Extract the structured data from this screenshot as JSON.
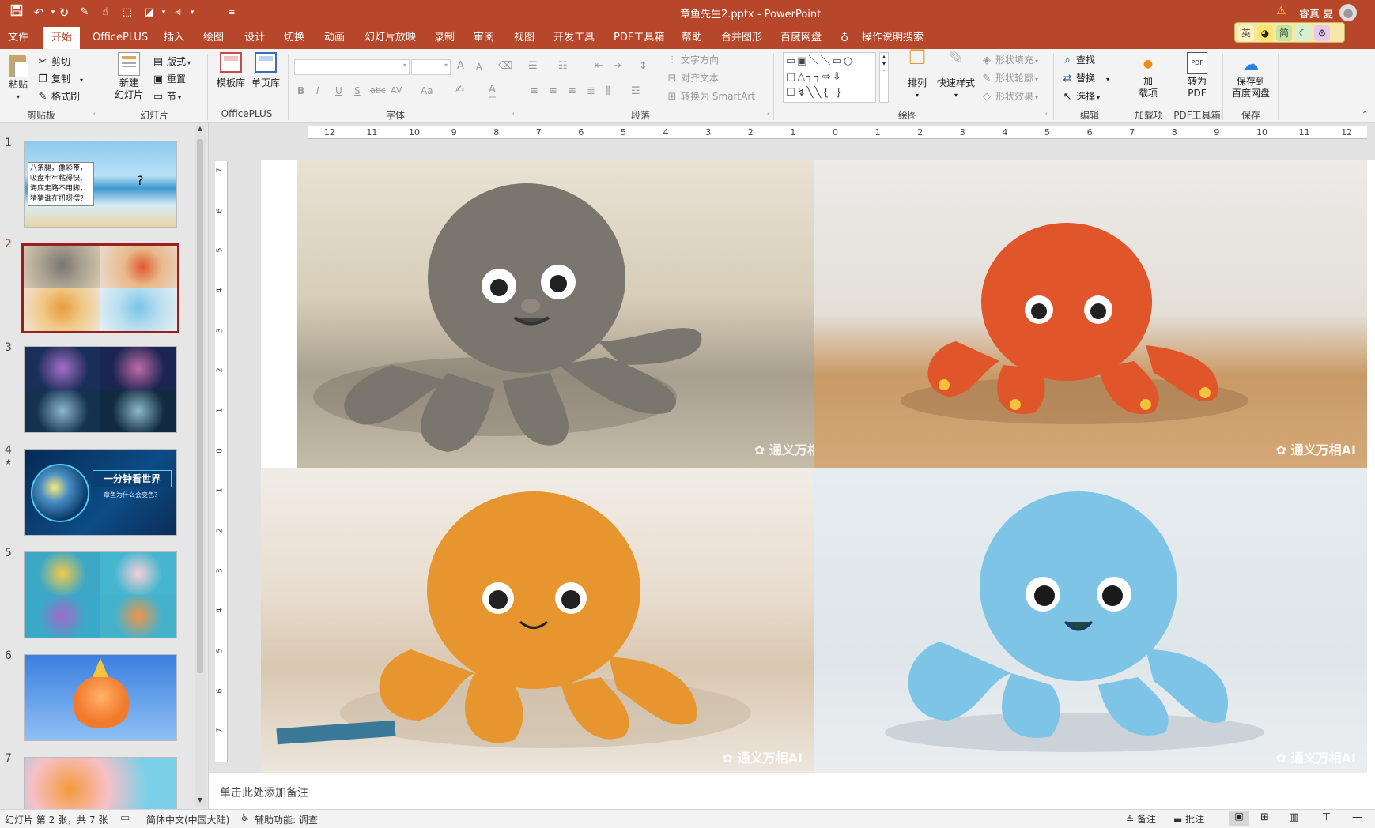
{
  "window": {
    "title": "章鱼先生2.pptx  -  PowerPoint",
    "user": "睿真 夏",
    "warning_icon": "warning-icon"
  },
  "qat": {
    "icons": [
      "save-icon",
      "undo-icon",
      "redo-icon",
      "format-painter-icon",
      "touch-icon",
      "select-icon",
      "shapes-icon",
      "align-icon",
      "more-icon"
    ]
  },
  "badges": [
    "英",
    "简"
  ],
  "tabs": [
    "文件",
    "开始",
    "OfficePLUS",
    "插入",
    "绘图",
    "设计",
    "切换",
    "动画",
    "幻灯片放映",
    "录制",
    "审阅",
    "视图",
    "开发工具",
    "PDF工具箱",
    "帮助",
    "合并图形",
    "百度网盘"
  ],
  "active_tab": "开始",
  "tell_me": "操作说明搜索",
  "ribbon": {
    "clipboard": {
      "paste": "粘贴",
      "cut": "剪切",
      "copy": "复制",
      "painter": "格式刷",
      "label": "剪贴板"
    },
    "slides": {
      "new": "新建\n幻灯片",
      "layout": "版式",
      "reset": "重置",
      "section": "节",
      "label": "幻灯片"
    },
    "officeplus": {
      "template": "模板库",
      "single": "单页库",
      "label": "OfficePLUS"
    },
    "font": {
      "label": "字体",
      "bold": "B",
      "italic": "I",
      "underline": "U",
      "strike": "S",
      "abc": "abc",
      "spacing": "AV",
      "case": "Aa",
      "grow": "A",
      "shrink": "A",
      "color": "A"
    },
    "paragraph": {
      "label": "段落",
      "text_dir": "文字方向",
      "align_text": "对齐文本",
      "smartart": "转换为 SmartArt"
    },
    "drawing": {
      "label": "绘图",
      "arrange": "排列",
      "quick_styles": "快速样式",
      "fill": "形状填充",
      "outline": "形状轮廓",
      "effects": "形状效果"
    },
    "editing": {
      "label": "编辑",
      "find": "查找",
      "replace": "替换",
      "select": "选择"
    },
    "addin": {
      "label": "加载项",
      "btn": "加\n载项"
    },
    "pdf": {
      "label": "PDF工具箱",
      "btn": "转为\nPDF"
    },
    "save": {
      "label": "保存",
      "btn": "保存到\n百度网盘"
    }
  },
  "thumbnails": [
    {
      "num": "1",
      "text": "八条腿，像彩带，\n吸盘牢牢粘得快，\n海底走路不用脚，\n猜猜谁在扭呀摆？",
      "mark": "?"
    },
    {
      "num": "2"
    },
    {
      "num": "3"
    },
    {
      "num": "4",
      "star": "★",
      "title": "一分钟看世界",
      "sub": "章鱼为什么会变色？"
    },
    {
      "num": "5"
    },
    {
      "num": "6"
    },
    {
      "num": "7"
    }
  ],
  "ruler": {
    "h": [
      "12",
      "11",
      "10",
      "9",
      "8",
      "7",
      "6",
      "5",
      "4",
      "3",
      "2",
      "1",
      "0",
      "1",
      "2",
      "3",
      "4",
      "5",
      "6",
      "7",
      "8",
      "9",
      "10",
      "11",
      "12"
    ],
    "v": [
      "7",
      "6",
      "5",
      "4",
      "3",
      "2",
      "1",
      "0",
      "1",
      "2",
      "3",
      "4",
      "5",
      "6",
      "7"
    ]
  },
  "slide": {
    "watermark": "通义万相AI",
    "watermark_cut": "通义万相"
  },
  "notes": {
    "placeholder": "单击此处添加备注"
  },
  "status": {
    "slide_info": "幻灯片 第 2 张，共 7 张",
    "language": "简体中文(中国大陆)",
    "accessibility": "辅助功能: 调查",
    "notes": "备注",
    "comments": "批注"
  }
}
